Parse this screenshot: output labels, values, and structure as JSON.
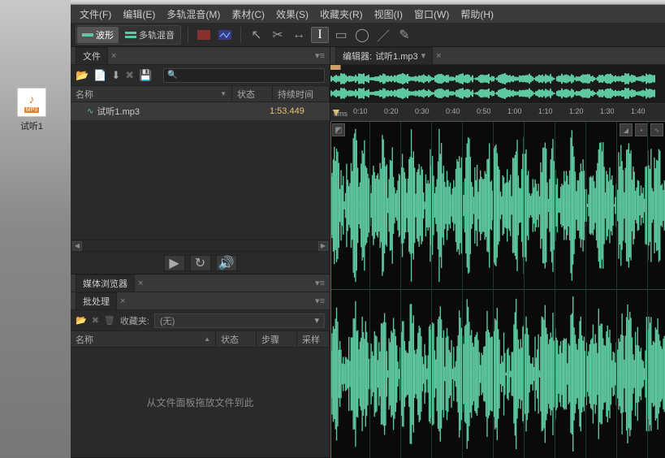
{
  "desktop": {
    "file_badge": "MP3",
    "file_label": "试听1"
  },
  "menu": {
    "file": "文件(F)",
    "edit": "编辑(E)",
    "multitrack": "多轨混音(M)",
    "clip": "素材(C)",
    "effects": "效果(S)",
    "favorites": "收藏夹(R)",
    "view": "视图(I)",
    "window": "窗口(W)",
    "help": "帮助(H)"
  },
  "toolbar": {
    "waveform": "波形",
    "multitrack": "多轨混音"
  },
  "files_panel": {
    "title": "文件",
    "col_name": "名称",
    "col_status": "状态",
    "col_duration": "持续时间",
    "file_name": "试听1.mp3",
    "file_duration": "1:53.449"
  },
  "media_browser": {
    "title": "媒体浏览器"
  },
  "batch": {
    "title": "批处理",
    "fav_label": "收藏夹:",
    "fav_value": "(无)",
    "col_name": "名称",
    "col_status": "状态",
    "col_step": "步骤",
    "col_sample": "采样",
    "drop_hint": "从文件面板拖放文件到此"
  },
  "editor": {
    "title_prefix": "编辑器:",
    "file_name": "试听1.mp3",
    "ruler_unit": "hms",
    "ruler_ticks": [
      "0:10",
      "0:20",
      "0:30",
      "0:40",
      "0:50",
      "1:00",
      "1:10",
      "1:20",
      "1:30",
      "1:40"
    ]
  },
  "colors": {
    "waveform": "#5ec8a0",
    "accent_orange": "#e8c070",
    "playhead": "#d04040"
  }
}
